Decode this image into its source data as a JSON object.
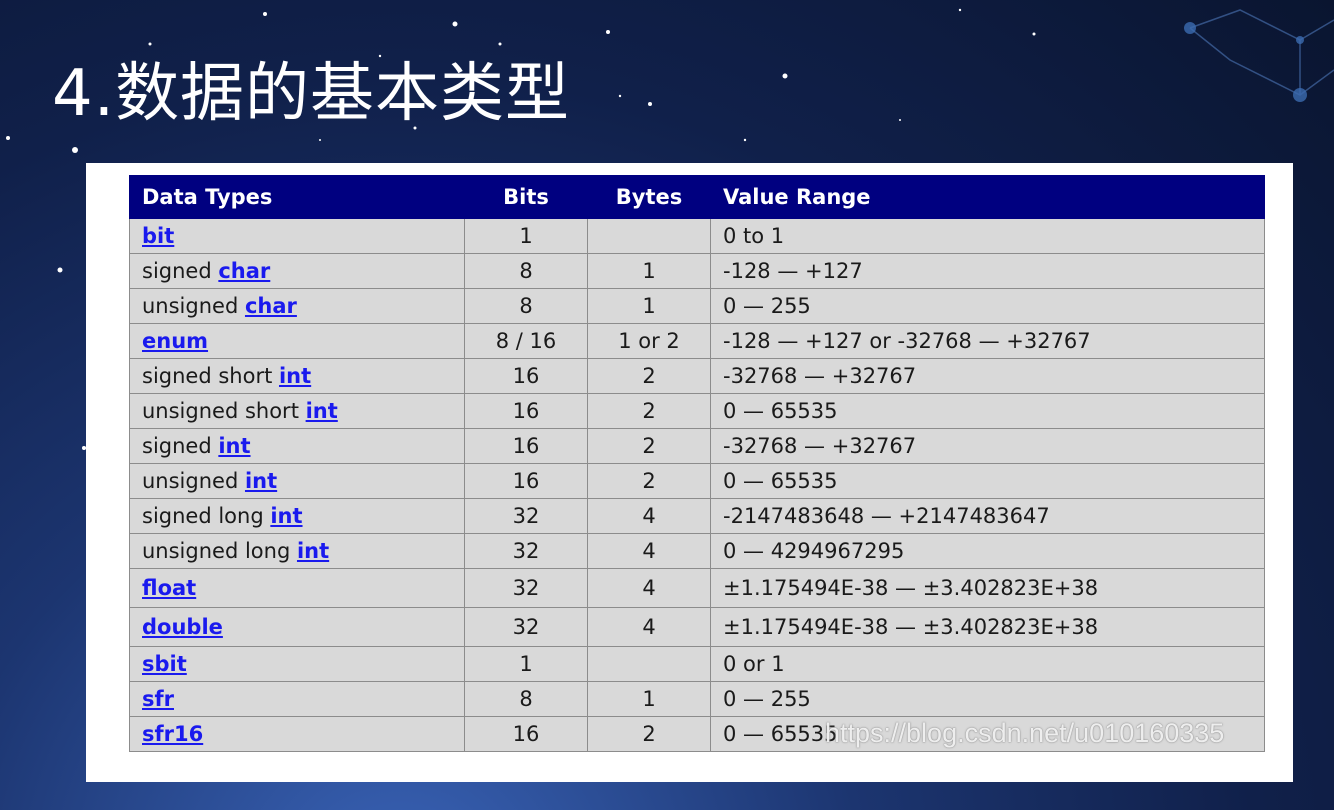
{
  "slide": {
    "title": "4.数据的基本类型"
  },
  "table": {
    "headers": {
      "type": "Data Types",
      "bits": "Bits",
      "bytes": "Bytes",
      "range": "Value Range"
    },
    "rows": [
      {
        "prefix": "",
        "keyword": "bit",
        "bits": "1",
        "bytes": "",
        "range": "0 to 1"
      },
      {
        "prefix": "signed ",
        "keyword": "char",
        "bits": "8",
        "bytes": "1",
        "range": "-128 — +127"
      },
      {
        "prefix": "unsigned ",
        "keyword": "char",
        "bits": "8",
        "bytes": "1",
        "range": "0 — 255"
      },
      {
        "prefix": "",
        "keyword": "enum",
        "bits": "8 / 16",
        "bytes": "1 or 2",
        "range": "-128 — +127 or -32768 — +32767"
      },
      {
        "prefix": "signed short ",
        "keyword": "int",
        "bits": "16",
        "bytes": "2",
        "range": "-32768 — +32767"
      },
      {
        "prefix": "unsigned short ",
        "keyword": "int",
        "bits": "16",
        "bytes": "2",
        "range": "0 — 65535"
      },
      {
        "prefix": "signed ",
        "keyword": "int",
        "bits": "16",
        "bytes": "2",
        "range": "-32768 — +32767"
      },
      {
        "prefix": "unsigned ",
        "keyword": "int",
        "bits": "16",
        "bytes": "2",
        "range": "0 — 65535"
      },
      {
        "prefix": "signed long ",
        "keyword": "int",
        "bits": "32",
        "bytes": "4",
        "range": "-2147483648 — +2147483647"
      },
      {
        "prefix": "unsigned long ",
        "keyword": "int",
        "bits": "32",
        "bytes": "4",
        "range": "0 — 4294967295"
      },
      {
        "prefix": "",
        "keyword": "float",
        "bits": "32",
        "bytes": "4",
        "range": "±1.175494E-38 — ±3.402823E+38"
      },
      {
        "prefix": "",
        "keyword": "double",
        "bits": "32",
        "bytes": "4",
        "range": "±1.175494E-38 — ±3.402823E+38"
      },
      {
        "prefix": "",
        "keyword": "sbit",
        "bits": "1",
        "bytes": "",
        "range": "0 or 1"
      },
      {
        "prefix": "",
        "keyword": "sfr",
        "bits": "8",
        "bytes": "1",
        "range": "0 — 255"
      },
      {
        "prefix": "",
        "keyword": "sfr16",
        "bits": "16",
        "bytes": "2",
        "range": "0 — 65535"
      }
    ]
  },
  "watermark": "https://blog.csdn.net/u010160335",
  "colors": {
    "header_bg": "#000080",
    "link": "#1a1aee",
    "row_bg": "#d9d9d9"
  }
}
